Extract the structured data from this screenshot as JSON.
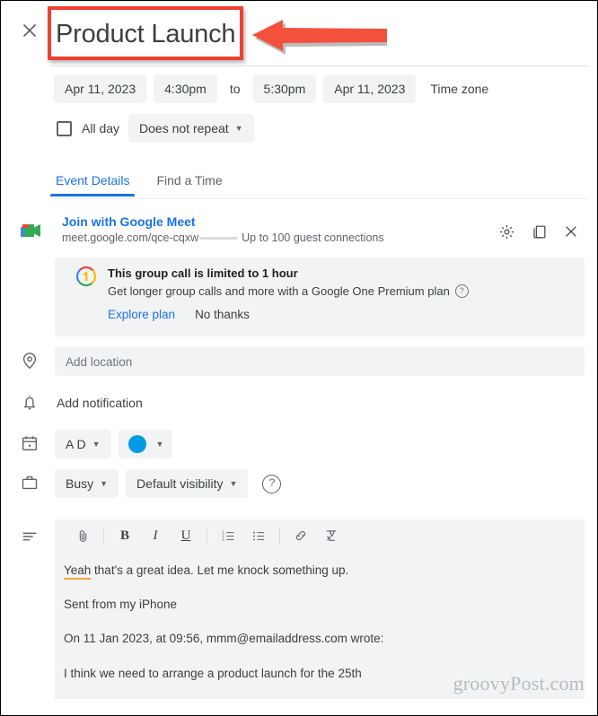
{
  "header": {
    "close_icon": "close-icon",
    "title_value": "Product Launch",
    "title_placeholder": "Add title"
  },
  "annotation": {
    "box_color": "#ef4130",
    "arrow_color": "#f4513c",
    "points_to": "event-title-input"
  },
  "datetime": {
    "start_date": "Apr 11, 2023",
    "start_time": "4:30pm",
    "to_label": "to",
    "end_time": "5:30pm",
    "end_date": "Apr 11, 2023",
    "timezone_label": "Time zone",
    "all_day_label": "All day",
    "all_day_checked": false,
    "repeat_label": "Does not repeat"
  },
  "tabs": [
    {
      "label": "Event Details",
      "active": true
    },
    {
      "label": "Find a Time",
      "active": false
    }
  ],
  "meet": {
    "icon": "google-meet-icon",
    "join_label": "Join with Google Meet",
    "url": "meet.google.com/qce-cqxw",
    "guests_note": "Up to 100 guest connections",
    "settings_icon": "gear-icon",
    "copy_icon": "copy-icon",
    "remove_icon": "close-icon"
  },
  "callout": {
    "badge_icon": "google-one-icon",
    "title": "This group call is limited to 1 hour",
    "subtitle": "Get longer group calls and more with a Google One Premium plan",
    "help_icon": "help-icon",
    "primary_link": "Explore plan",
    "secondary_link": "No thanks"
  },
  "location": {
    "icon": "location-pin-icon",
    "placeholder": "Add location",
    "value": ""
  },
  "notification": {
    "icon": "bell-icon",
    "label": "Add notification"
  },
  "calendar": {
    "icon": "calendar-icon",
    "owner_label": "A D",
    "color_hex": "#039be5"
  },
  "availability": {
    "icon": "briefcase-icon",
    "busy_label": "Busy",
    "visibility_label": "Default visibility",
    "help_icon": "help-icon"
  },
  "description": {
    "icon": "description-lines-icon",
    "toolbar": [
      {
        "name": "attach-icon",
        "glyph": "attach"
      },
      {
        "name": "bold-icon",
        "glyph": "B"
      },
      {
        "name": "italic-icon",
        "glyph": "I"
      },
      {
        "name": "underline-icon",
        "glyph": "U"
      },
      {
        "name": "numbered-list-icon",
        "glyph": "ol"
      },
      {
        "name": "bulleted-list-icon",
        "glyph": "ul"
      },
      {
        "name": "link-icon",
        "glyph": "link"
      },
      {
        "name": "clear-formatting-icon",
        "glyph": "clear"
      }
    ],
    "line1_misspelled": "Yeah",
    "line1_rest": " that's a great idea. Let me knock something up.",
    "line2": "Sent from my iPhone",
    "line3": "On 11 Jan 2023, at 09:56, mmm@emailaddress.com wrote:",
    "line4": "I think we need to arrange a product launch for the 25th"
  },
  "watermark": "groovyPost.com",
  "colors": {
    "accent_blue": "#1a73e8",
    "chip_grey": "#f1f3f4",
    "text_primary": "#3c4043",
    "text_secondary": "#5f6368"
  }
}
